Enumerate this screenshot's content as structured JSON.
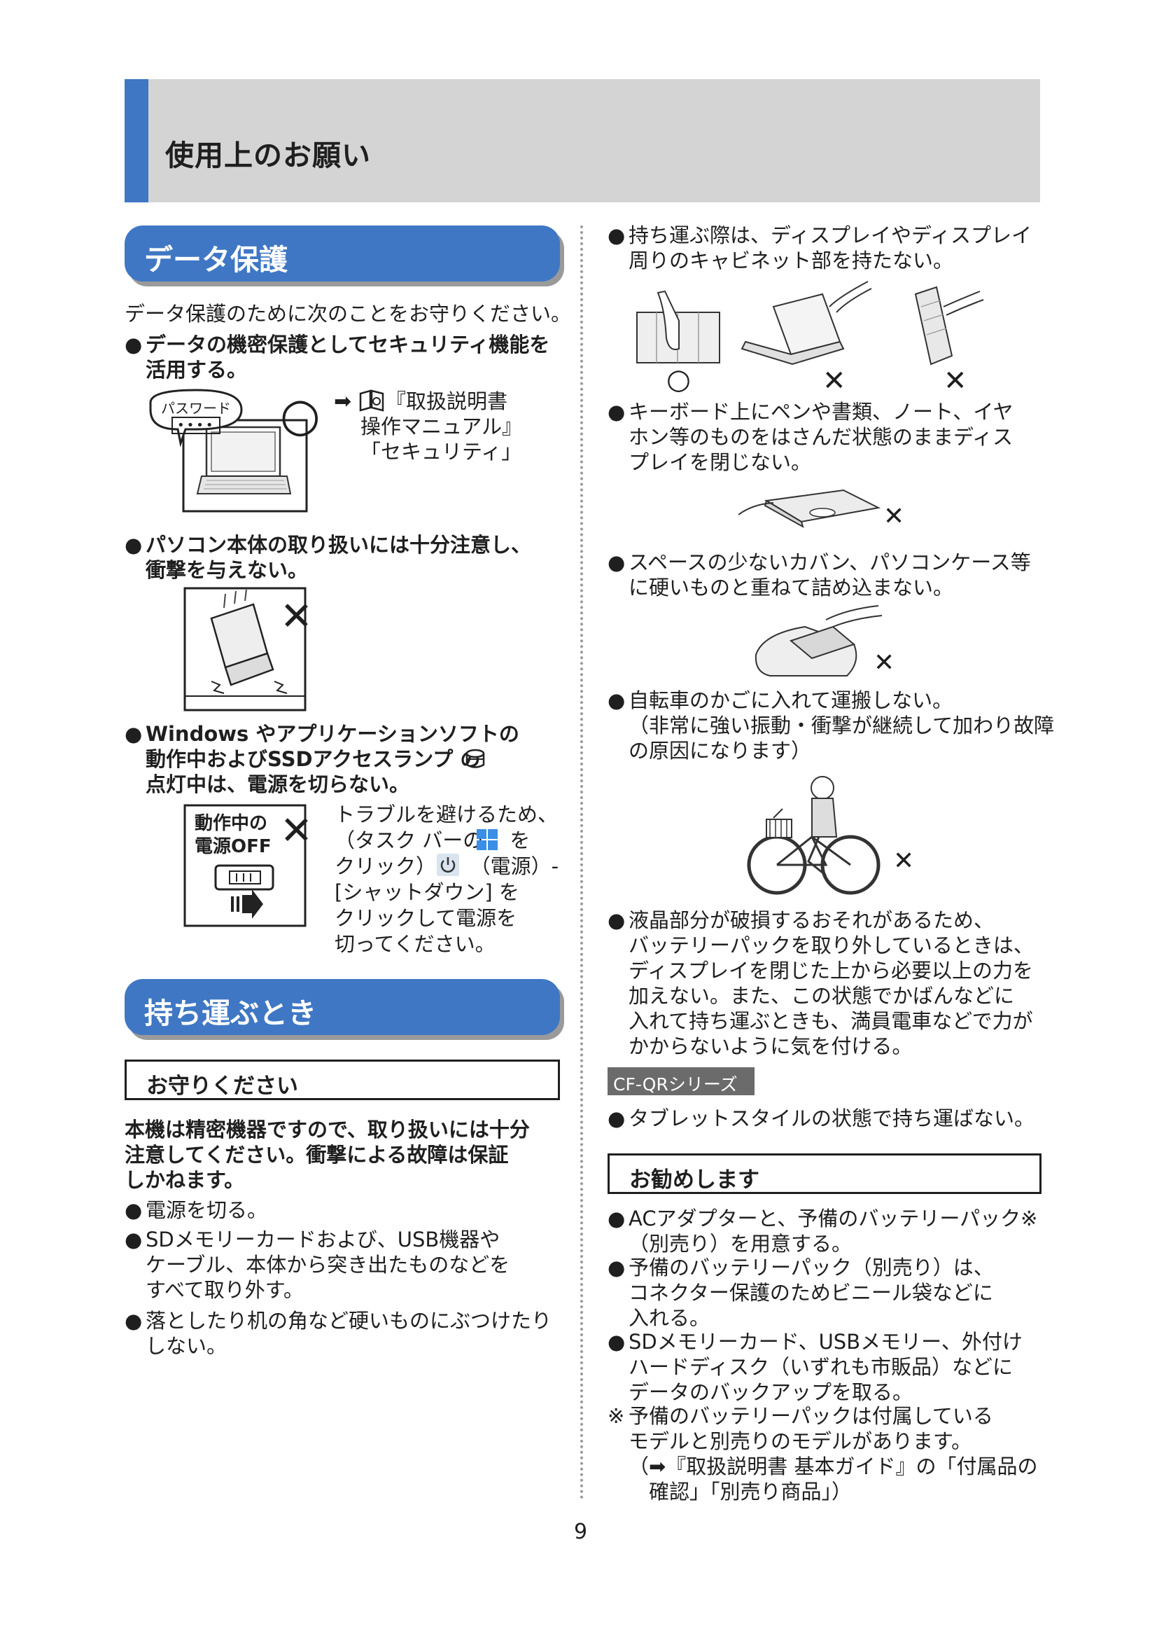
{
  "header": {
    "title": "使用上のお願い"
  },
  "left": {
    "section1_title": "データ保護",
    "intro": "データ保護のために次のことをお守りください。",
    "b1": "データの機密保護としてセキュリティ機能を\n活用する。",
    "password_label": "パスワード",
    "password_dots": "••••",
    "ref_arrow": "➡",
    "ref_text": "『取扱説明書\n操作マニュアル』\n「セキュリティ」",
    "ok_mark": "○",
    "b2": "パソコン本体の取り扱いには十分注意し、\n衝撃を与えない。",
    "ng_mark": "✕",
    "b3": "Windows やアプリケーションソフトの\n動作中およびSSDアクセスランプ    の\n点灯中は、電源を切らない。",
    "power_box_label": "動作中の\n電源OFF",
    "power_note": "トラブルを避けるため、\n（タスク バーの　 を\nクリック）-　 （電源）-\n[シャットダウン] を\nクリックして電源を\n切ってください。",
    "section2_title": "持ち運ぶとき",
    "box_heading": "お守りください",
    "notice": "本機は精密機器ですので、取り扱いには十分\n注意してください。衝撃による故障は保証\nしかねます。",
    "c1": "電源を切る。",
    "c2": "SDメモリーカードおよび、USB機器や\nケーブル、本体から突き出たものなどを\nすべて取り外す。",
    "c3": "落としたり机の角など硬いものにぶつけたり\nしない。"
  },
  "right": {
    "r1": "持ち運ぶ際は、ディスプレイやディスプレイ\n周りのキャビネット部を持たない。",
    "r2": "キーボード上にペンや書類、ノート、イヤ\nホン等のものをはさんだ状態のままディス\nプレイを閉じない。",
    "r3": "スペースの少ないカバン、パソコンケース等\nに硬いものと重ねて詰め込まない。",
    "r4": "自転車のかごに入れて運搬しない。",
    "r4_note": "（非常に強い振動・衝撃が継続して加わり故障\nの原因になります）",
    "r5": "液晶部分が破損するおそれがあるため、\nバッテリーパックを取り外しているときは、\nディスプレイを閉じた上から必要以上の力を\n加えない。また、この状態でかばんなどに\n入れて持ち運ぶときも、満員電車などで力が\nかからないように気を付ける。",
    "series_badge": "CF-QRシリーズ",
    "r6": "タブレットスタイルの状態で持ち運ばない。",
    "box_heading": "お勧めします",
    "s1": "ACアダプターと、予備のバッテリーパック※\n（別売り）を用意する。",
    "s2": "予備のバッテリーパック（別売り）は、\nコネクター保護のためビニール袋などに\n入れる。",
    "s3": "SDメモリーカード、USBメモリー、外付け\nハードディスク（いずれも市販品）などに\nデータのバックアップを取る。",
    "footnote_mark": "※",
    "footnote": "予備のバッテリーパックは付属している\nモデルと別売りのモデルがあります。\n（➡『取扱説明書 基本ガイド』の「付属品の\n　確認」「別売り商品」）",
    "ok_mark": "○",
    "ng_mark": "✕"
  },
  "page_number": "9",
  "bullet_char": "●",
  "colors": {
    "accent": "#3f77c4",
    "band": "#d4d4d4",
    "badge": "#6b6b6b"
  }
}
